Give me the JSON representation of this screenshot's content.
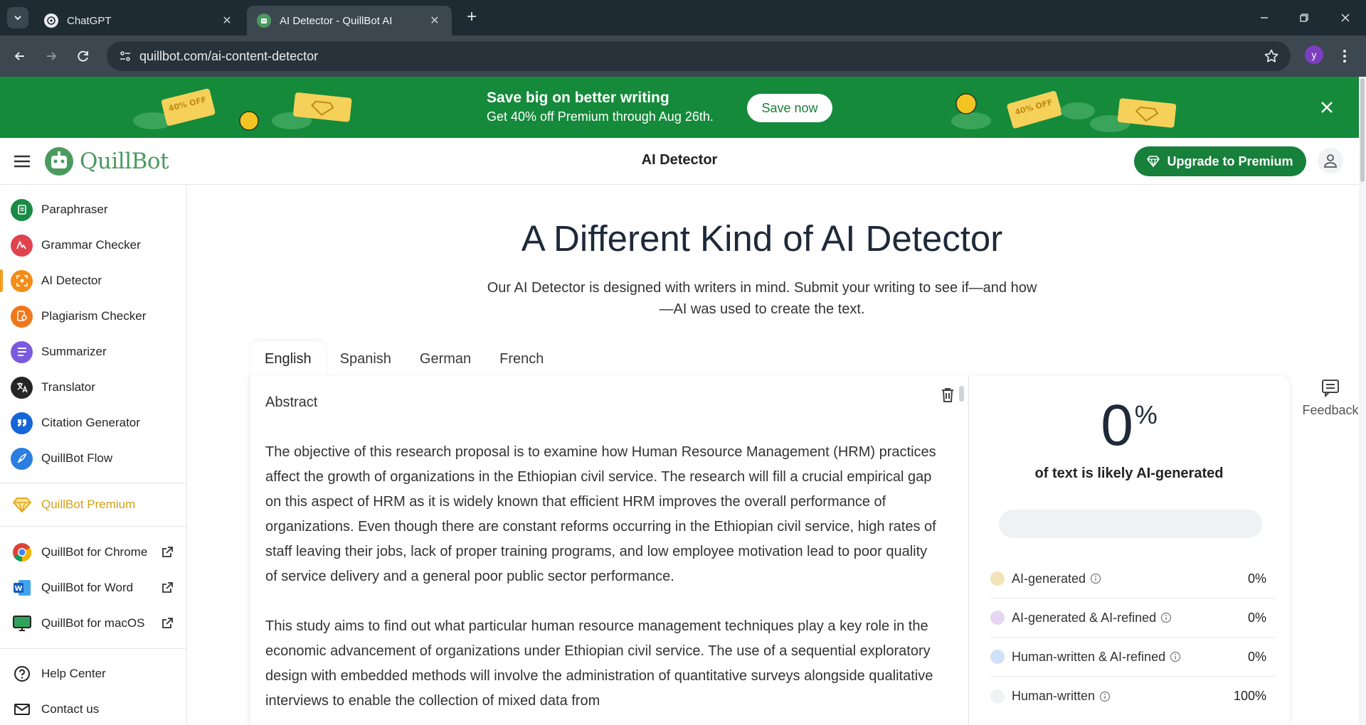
{
  "browser": {
    "tabs": [
      {
        "title": "ChatGPT",
        "active": false
      },
      {
        "title": "AI Detector - QuillBot AI",
        "active": true
      }
    ],
    "url": "quillbot.com/ai-content-detector",
    "profile_initial": "y"
  },
  "promo": {
    "title": "Save big on better writing",
    "subtitle": "Get 40% off Premium through Aug 26th.",
    "button": "Save now",
    "ticket_text": "40% OFF"
  },
  "header": {
    "logo": "QuillBot",
    "title": "AI Detector",
    "upgrade": "Upgrade to Premium"
  },
  "sidebar": {
    "items": [
      {
        "label": "Paraphraser",
        "icon": "paraphraser-icon",
        "color": "#1b8a47"
      },
      {
        "label": "Grammar Checker",
        "icon": "grammar-icon",
        "color": "#e0434f"
      },
      {
        "label": "AI Detector",
        "icon": "ai-detector-icon",
        "color": "#f28d1a",
        "active": true
      },
      {
        "label": "Plagiarism Checker",
        "icon": "plagiarism-icon",
        "color": "#f0781b"
      },
      {
        "label": "Summarizer",
        "icon": "summarizer-icon",
        "color": "#7b5ae0"
      },
      {
        "label": "Translator",
        "icon": "translator-icon",
        "color": "#252525"
      },
      {
        "label": "Citation Generator",
        "icon": "citation-icon",
        "color": "#1565d8"
      },
      {
        "label": "QuillBot Flow",
        "icon": "flow-icon",
        "color": "#2b7de0"
      }
    ],
    "premium": "QuillBot Premium",
    "extensions": [
      {
        "label": "QuillBot for Chrome",
        "icon": "chrome-icon"
      },
      {
        "label": "QuillBot for Word",
        "icon": "word-icon"
      },
      {
        "label": "QuillBot for macOS",
        "icon": "macos-icon"
      }
    ],
    "support": [
      {
        "label": "Help Center",
        "icon": "help-icon"
      },
      {
        "label": "Contact us",
        "icon": "mail-icon"
      }
    ]
  },
  "main": {
    "title": "A Different Kind of AI Detector",
    "subtitle": "Our AI Detector is designed with writers in mind. Submit your writing to see if—and how—AI was used to create the text.",
    "languages": [
      "English",
      "Spanish",
      "German",
      "French"
    ],
    "selected_language": "English",
    "editor": {
      "paragraphs": [
        "Abstract",
        "The objective of this research proposal is to examine how Human Resource Management (HRM) practices affect the growth of organizations in the Ethiopian civil service. The research will fill a crucial empirical gap on this aspect of HRM as it is widely known that efficient HRM improves the overall performance of organizations. Even though there are constant reforms occurring in the Ethiopian civil service, high rates of staff leaving their jobs, lack of proper training programs, and low employee motivation lead to poor quality of service delivery and a general poor public sector performance.",
        "This study aims to find out what particular human resource management techniques play a key role in the economic advancement of organizations under Ethiopian civil service. The use of a sequential exploratory design with embedded methods will involve the administration of quantitative surveys alongside qualitative interviews to enable the collection of mixed data from"
      ]
    },
    "results": {
      "percent": "0",
      "percent_sign": "%",
      "caption": "of text is likely AI-generated",
      "meter_fill": 0,
      "categories": [
        {
          "label": "AI-generated",
          "value": "0%",
          "color": "#f2e4b8"
        },
        {
          "label": "AI-generated & AI-refined",
          "value": "0%",
          "color": "#e6d6f4"
        },
        {
          "label": "Human-written & AI-refined",
          "value": "0%",
          "color": "#cfe1f6"
        },
        {
          "label": "Human-written",
          "value": "100%",
          "color": "#f1f2f4"
        }
      ]
    },
    "feedback": "Feedback"
  },
  "colors": {
    "brand_green": "#158a3b",
    "tab_bar": "#1f2b33",
    "address_bar": "#3c4750",
    "active_accent": "#f59b1b"
  }
}
